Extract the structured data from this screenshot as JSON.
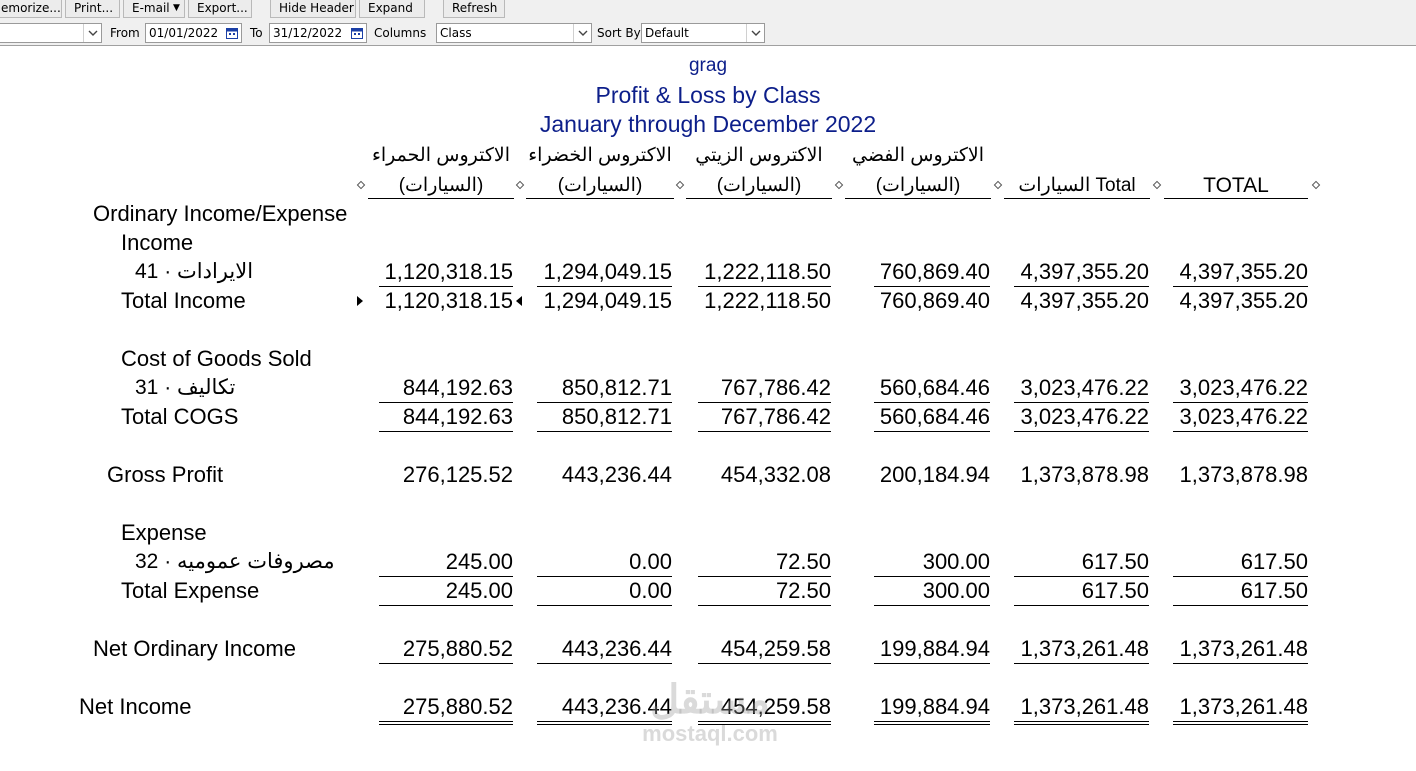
{
  "toolbar": {
    "buttons": [
      "emorize...",
      "Print...",
      "E-mail",
      "Export...",
      "Hide Header",
      "Expand",
      "Refresh"
    ]
  },
  "filters": {
    "dates_value": "",
    "from_label": "From",
    "from_value": "01/01/2022",
    "to_label": "To",
    "to_value": "31/12/2022",
    "columns_label": "Columns",
    "columns_value": "Class",
    "sortby_label": "Sort By",
    "sortby_value": "Default"
  },
  "report": {
    "company": "grag",
    "title": "Profit & Loss by Class",
    "period": "January through December 2022",
    "columns": [
      {
        "line1": "الاكتروس الحمراء",
        "line2": "(السيارات)"
      },
      {
        "line1": "الاكتروس الخضراء",
        "line2": "(السيارات)"
      },
      {
        "line1": "الاكتروس الزيتي",
        "line2": "(السيارات)"
      },
      {
        "line1": "الاكتروس الفضي",
        "line2": "(السيارات)"
      },
      {
        "line1": "",
        "line2": "السيارات Total"
      },
      {
        "line1": "",
        "line2": "TOTAL"
      }
    ],
    "rows": {
      "ordinary": "Ordinary Income/Expense",
      "income": "Income",
      "income_acct": "الايرادات · 41",
      "income_acct_values": [
        "1,120,318.15",
        "1,294,049.15",
        "1,222,118.50",
        "760,869.40",
        "4,397,355.20",
        "4,397,355.20"
      ],
      "total_income": "Total Income",
      "total_income_values": [
        "1,120,318.15",
        "1,294,049.15",
        "1,222,118.50",
        "760,869.40",
        "4,397,355.20",
        "4,397,355.20"
      ],
      "cogs": "Cost of Goods Sold",
      "cogs_acct": "تكاليف · 31",
      "cogs_acct_values": [
        "844,192.63",
        "850,812.71",
        "767,786.42",
        "560,684.46",
        "3,023,476.22",
        "3,023,476.22"
      ],
      "total_cogs": "Total COGS",
      "total_cogs_values": [
        "844,192.63",
        "850,812.71",
        "767,786.42",
        "560,684.46",
        "3,023,476.22",
        "3,023,476.22"
      ],
      "gross_profit": "Gross Profit",
      "gross_profit_values": [
        "276,125.52",
        "443,236.44",
        "454,332.08",
        "200,184.94",
        "1,373,878.98",
        "1,373,878.98"
      ],
      "expense": "Expense",
      "expense_acct": "مصروفات عموميه · 32",
      "expense_acct_values": [
        "245.00",
        "0.00",
        "72.50",
        "300.00",
        "617.50",
        "617.50"
      ],
      "total_expense": "Total Expense",
      "total_expense_values": [
        "245.00",
        "0.00",
        "72.50",
        "300.00",
        "617.50",
        "617.50"
      ],
      "net_ordinary": "Net Ordinary Income",
      "net_ordinary_values": [
        "275,880.52",
        "443,236.44",
        "454,259.58",
        "199,884.94",
        "1,373,261.48",
        "1,373,261.48"
      ],
      "net_income": "Net Income",
      "net_income_values": [
        "275,880.52",
        "443,236.44",
        "454,259.58",
        "199,884.94",
        "1,373,261.48",
        "1,373,261.48"
      ]
    }
  },
  "watermark": {
    "arabic": "مستقل",
    "latin": "mostaql.com"
  }
}
